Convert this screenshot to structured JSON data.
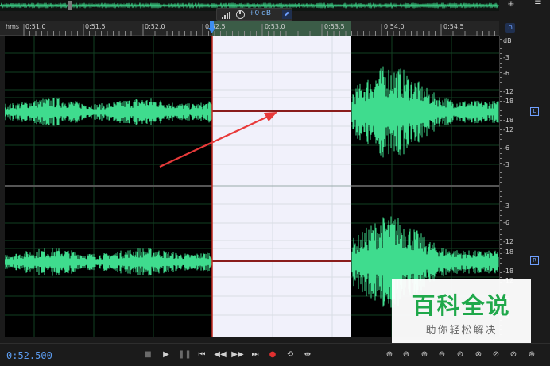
{
  "hud": {
    "gain": "+0 dB"
  },
  "ruler": {
    "unit": "hms",
    "ticks": [
      "0:51.0",
      "0:51.5",
      "0:52.0",
      "0:52.5",
      "0:53.0",
      "0:53.5",
      "0:54.0",
      "0:54.5"
    ]
  },
  "db_scale": {
    "unit": "dB",
    "left_labels": [
      "-3",
      "-6",
      "-12",
      "-18",
      "-18",
      "-12",
      "-6",
      "-3"
    ],
    "right_labels": [
      "-3",
      "-6",
      "-12",
      "-18",
      "-18",
      "-12",
      "-6",
      "-3"
    ],
    "left_channel": "L",
    "right_channel": "R"
  },
  "transport": {
    "timecode": "0:52.500"
  },
  "watermark": {
    "title": "百科全说",
    "subtitle": "助你轻松解决"
  },
  "colors": {
    "waveform": "#3fdc8e",
    "selection": "#f1f1fb",
    "arrow": "#e83a3a",
    "timecode": "#5c9cf0"
  }
}
